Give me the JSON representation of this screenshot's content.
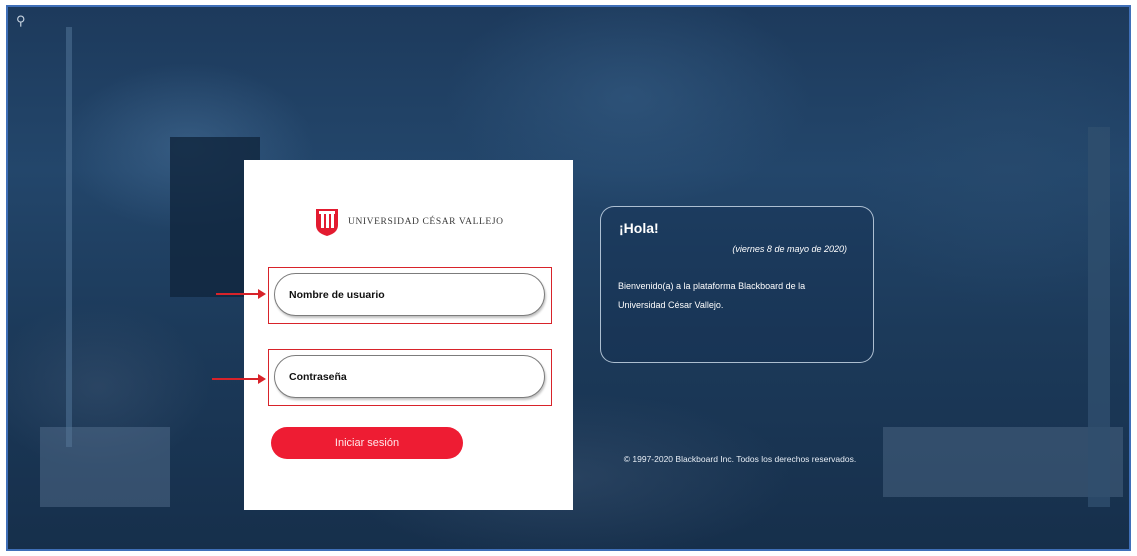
{
  "login": {
    "logo_text": "UNIVERSIDAD CÉSAR VALLEJO",
    "username_placeholder": "Nombre de usuario",
    "password_placeholder": "Contraseña",
    "login_button": "Iniciar sesión"
  },
  "welcome": {
    "title": "¡Hola!",
    "date": "(viernes 8 de mayo de 2020)",
    "message": "Bienvenido(a) a la plataforma Blackboard de la Universidad César Vallejo."
  },
  "footer": {
    "copyright": "© 1997-2020 Blackboard Inc. Todos los derechos reservados."
  },
  "colors": {
    "brand_red": "#ee1c33",
    "annotation_red": "#d8232a",
    "background_navy": "#1d3a5c"
  }
}
